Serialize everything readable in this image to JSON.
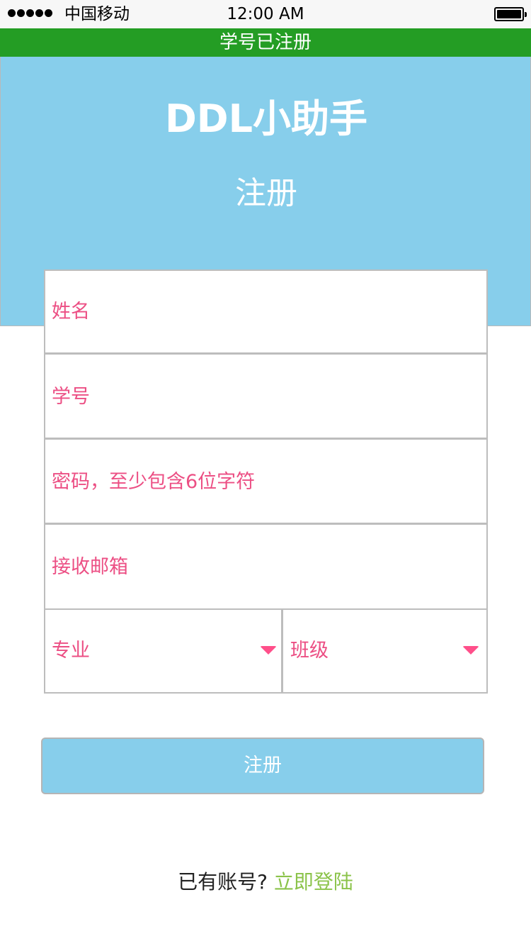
{
  "status_bar": {
    "carrier": "中国移动",
    "time": "12:00 AM",
    "signal_icon": "signal-dots-icon",
    "battery_icon": "battery-full-icon"
  },
  "toast": {
    "message": "学号已注册",
    "color": "#249d24"
  },
  "header": {
    "app_title": "DDL小助手",
    "page_title": "注册",
    "background_color": "#87ceeb"
  },
  "form": {
    "name_placeholder": "姓名",
    "student_id_placeholder": "学号",
    "password_placeholder": "密码，至少包含6位字符",
    "email_placeholder": "接收邮箱",
    "major_placeholder": "专业",
    "class_placeholder": "班级",
    "placeholder_color": "#ec4f84",
    "dropdown_icon": "caret-down-icon"
  },
  "submit": {
    "label": "注册"
  },
  "footer": {
    "prompt": "已有账号?",
    "login_link": "立即登陆",
    "link_color": "#8bc34a"
  }
}
